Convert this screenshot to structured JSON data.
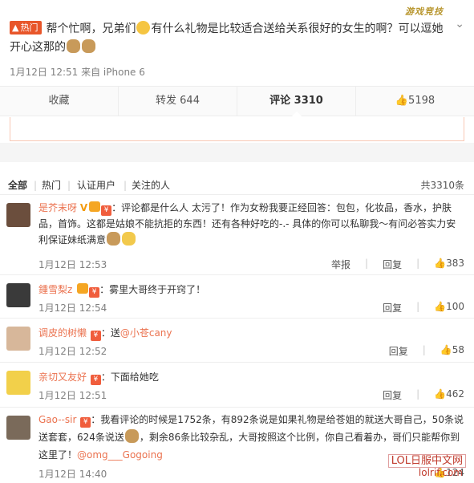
{
  "watermark_top": "游戏竞技",
  "post": {
    "hot_label": "热门",
    "text_1": "帮个忙啊，兄弟们",
    "text_2": "有什么礼物是比较适合送给关系很好的女生的啊？可以逗她开心这那的",
    "meta": "1月12日 12:51 来自 iPhone 6"
  },
  "actions": {
    "favorite": "收藏",
    "repost": "转发 644",
    "comment": "评论 3310",
    "like": "5198"
  },
  "filters": {
    "all": "全部",
    "hot": "热门",
    "verified": "认证用户",
    "following": "关注的人",
    "total": "共3310条"
  },
  "comments": [
    {
      "user": "是芥末呀",
      "text": "：评论都是什么人 太污了！作为女粉我要正经回答：包包，化妆品，香水，护肤品，首饰。这都是姑娘不能抗拒的东西！还有各种好吃的-.- 具体的你可以私聊我～有问必答实力安利保证妹纸满意",
      "time": "1月12日 12:53",
      "report": "举报",
      "reply": "回复",
      "likes": "383"
    },
    {
      "user": "鍾雪梨z",
      "text": "：雾里大哥终于开窍了！",
      "time": "1月12日 12:54",
      "reply": "回复",
      "likes": "100"
    },
    {
      "user": "调皮的树懒",
      "text_pre": "：送",
      "mention": "@小苍cany",
      "time": "1月12日 12:52",
      "reply": "回复",
      "likes": "58"
    },
    {
      "user": "亲切又友好",
      "text": "：下面给她吃",
      "time": "1月12日 12:51",
      "reply": "回复",
      "likes": "462"
    },
    {
      "user": "Gao--sir",
      "text_1": "：我看评论的时候是1752条，有892条说是如果礼物是给苍姐的就送大哥自己，50条说送套套，624条说送",
      "text_2": "，剩余86条比较杂乱，大哥按照这个比例，你自己看着办，哥们只能帮你到这里了！",
      "mention": "@omg___Gogoing",
      "time": "1月12日 14:40",
      "likes": "124"
    }
  ],
  "watermark_bottom": "LOL日服中文网",
  "watermark_bottom2": "lolrif.com",
  "colors": {
    "accent": "#eb7350",
    "hot_badge": "#e8562a"
  }
}
